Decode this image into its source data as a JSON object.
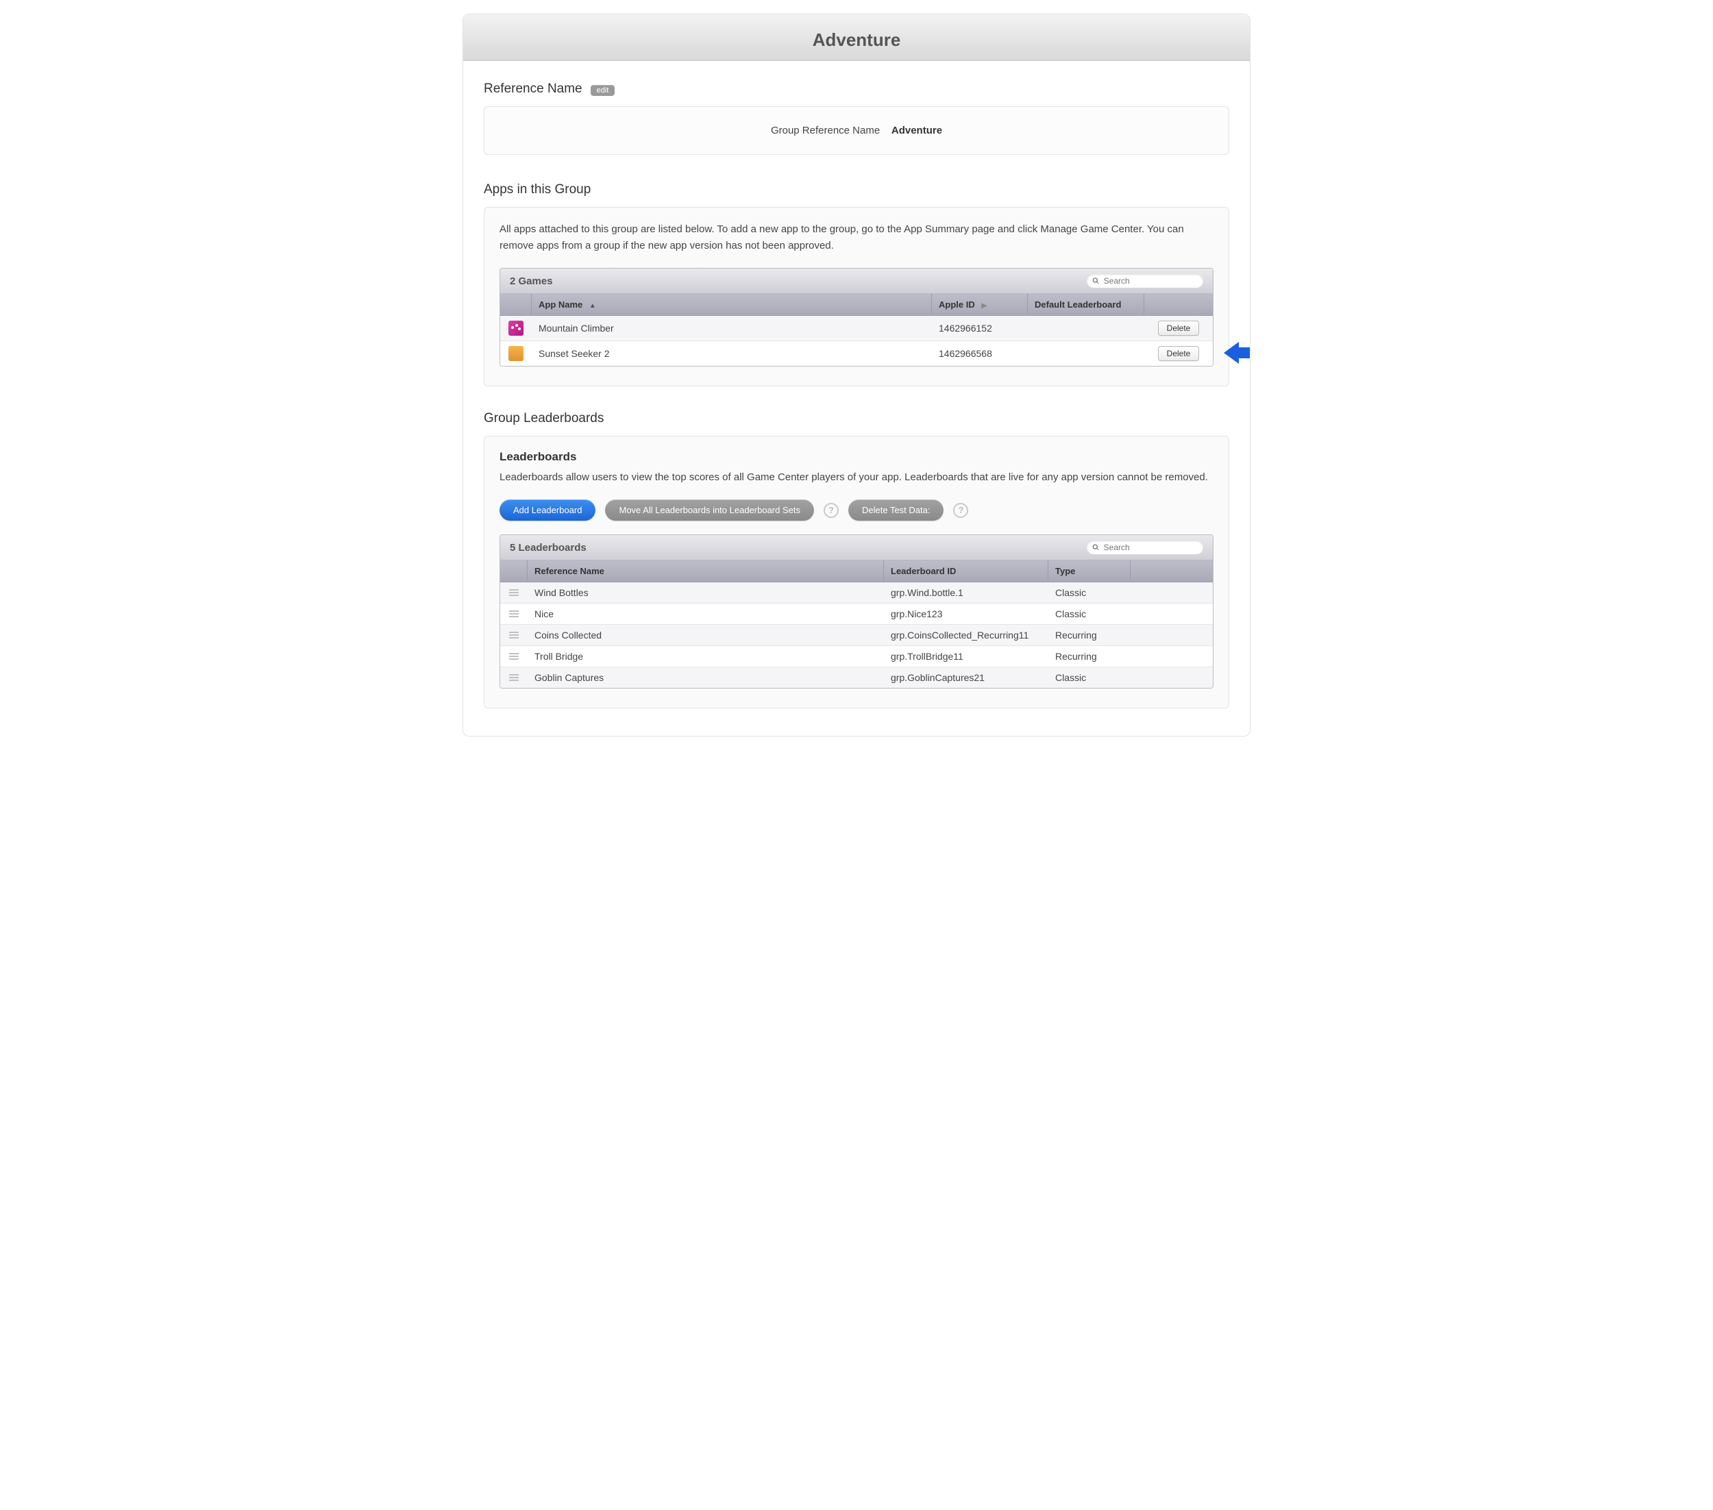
{
  "page_title": "Adventure",
  "reference": {
    "section_label": "Reference Name",
    "edit_label": "edit",
    "group_label": "Group Reference Name",
    "group_value": "Adventure"
  },
  "apps_section": {
    "heading": "Apps in this Group",
    "help": "All apps attached to this group are listed below. To add a new app to the group, go to the App Summary page and click Manage Game Center. You can remove apps from a group if the new app version has not been approved.",
    "count_label": "2 Games",
    "search_placeholder": "Search",
    "cols": {
      "name": "App Name",
      "apple_id": "Apple ID",
      "default_lb": "Default Leaderboard"
    },
    "rows": [
      {
        "icon": "pink",
        "name": "Mountain Climber",
        "apple_id": "1462966152",
        "default_lb": "",
        "delete_label": "Delete"
      },
      {
        "icon": "orange",
        "name": "Sunset Seeker 2",
        "apple_id": "1462966568",
        "default_lb": "",
        "delete_label": "Delete"
      }
    ]
  },
  "leaderboards_section": {
    "heading": "Group Leaderboards",
    "subheading": "Leaderboards",
    "help": "Leaderboards allow users to view the top scores of all Game Center players of your app. Leaderboards that are live for any app version cannot be removed.",
    "add_label": "Add Leaderboard",
    "move_label": "Move All Leaderboards into Leaderboard Sets",
    "delete_test_label": "Delete Test Data:",
    "count_label": "5 Leaderboards",
    "search_placeholder": "Search",
    "cols": {
      "ref": "Reference Name",
      "id": "Leaderboard ID",
      "type": "Type"
    },
    "rows": [
      {
        "ref": "Wind Bottles",
        "id": "grp.Wind.bottle.1",
        "type": "Classic"
      },
      {
        "ref": "Nice",
        "id": "grp.Nice123",
        "type": "Classic"
      },
      {
        "ref": "Coins Collected",
        "id": "grp.CoinsCollected_Recurring11",
        "type": "Recurring"
      },
      {
        "ref": "Troll Bridge",
        "id": "grp.TrollBridge11",
        "type": "Recurring"
      },
      {
        "ref": "Goblin Captures",
        "id": "grp.GoblinCaptures21",
        "type": "Classic"
      }
    ]
  },
  "help_symbol": "?"
}
